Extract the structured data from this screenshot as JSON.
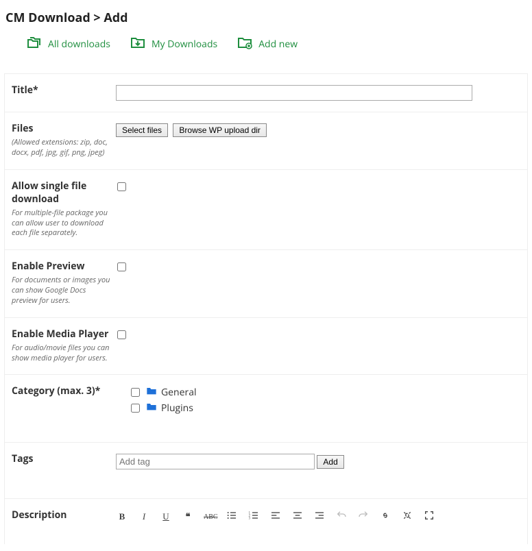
{
  "heading": "CM Download > Add",
  "nav": {
    "all": "All downloads",
    "my": "My Downloads",
    "add": "Add new"
  },
  "rows": {
    "title": {
      "label": "Title*",
      "value": ""
    },
    "files": {
      "label": "Files",
      "help": "(Allowed extensions: zip, doc, docx, pdf, jpg, gif, png, jpeg)",
      "btn_select": "Select files",
      "btn_browse": "Browse WP upload dir"
    },
    "single": {
      "label": "Allow single file download",
      "help": "For multiple-file package you can allow user to download each file separately."
    },
    "preview": {
      "label": "Enable Preview",
      "help": "For documents or images you can show Google Docs preview for users."
    },
    "media": {
      "label": "Enable Media Player",
      "help": "For audio/movie files you can show media player for users."
    },
    "category": {
      "label": "Category (max. 3)*",
      "items": [
        "General",
        "Plugins"
      ]
    },
    "tags": {
      "label": "Tags",
      "placeholder": "Add tag",
      "btn_add": "Add"
    },
    "description": {
      "label": "Description"
    }
  }
}
